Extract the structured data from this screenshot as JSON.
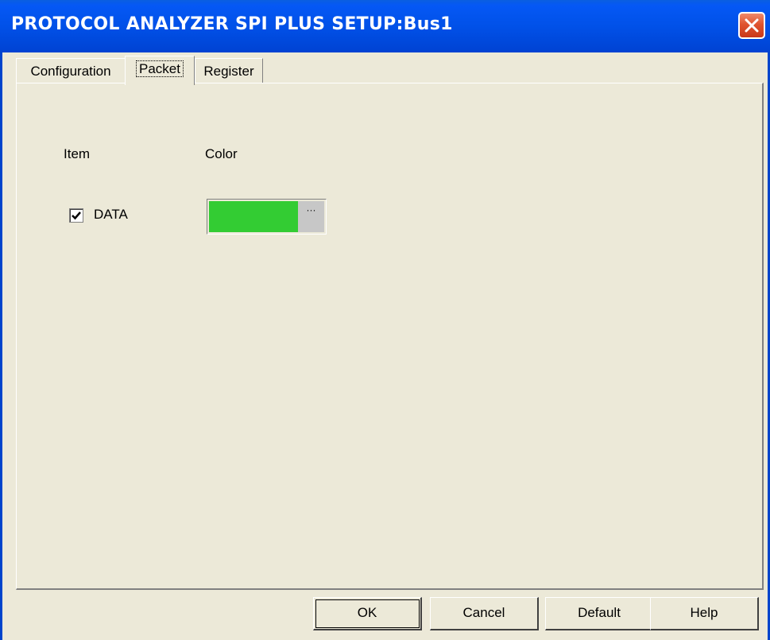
{
  "window": {
    "title": "PROTOCOL ANALYZER SPI PLUS SETUP:Bus1"
  },
  "tabs": [
    {
      "label": "Configuration",
      "active": false
    },
    {
      "label": "Packet",
      "active": true
    },
    {
      "label": "Register",
      "active": false
    }
  ],
  "packet": {
    "columns": {
      "item": "Item",
      "color": "Color"
    },
    "rows": [
      {
        "label": "DATA",
        "checked": true,
        "color": "#33cc33",
        "picker_label": "···"
      }
    ]
  },
  "footer": {
    "ok_label": "OK",
    "cancel_label": "Cancel",
    "default_label": "Default",
    "help_label": "Help"
  },
  "icons": {
    "close": "close-icon",
    "check": "checkmark-icon"
  },
  "colors": {
    "titlebar": "#0151e8",
    "dialog_bg": "#ece9d8",
    "close_btn": "#e0542f"
  }
}
